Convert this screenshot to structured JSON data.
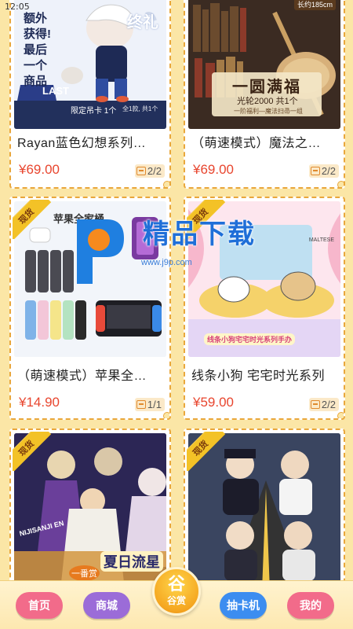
{
  "status_bar": {
    "time": "12:05"
  },
  "watermark": {
    "title": "精品下载",
    "url": "www.j9p.com"
  },
  "products": [
    {
      "title": "Rayan蓝色幻想系列…",
      "price": "¥69.00",
      "stock": "2/2",
      "badge": "",
      "image_text": {
        "lines": [
          "额外获得!",
          "最后",
          "一个商品"
        ],
        "corner": "终礼",
        "last": "LAST",
        "card": "限定吊卡 1个",
        "note": "全1款, 共1个"
      }
    },
    {
      "title": "（萌速模式）魔法之…",
      "price": "¥69.00",
      "stock": "2/2",
      "badge": "",
      "image_text": {
        "banner": "一圆满福",
        "sub": "光轮2000 共1个",
        "caption": "一阶福利—魔法扫帚一组",
        "tag": "长约185cm"
      }
    },
    {
      "title": "（萌速模式）苹果全…",
      "price": "¥14.90",
      "stock": "1/1",
      "badge": "现货",
      "image_text": {
        "header": "苹果全家桶"
      }
    },
    {
      "title": "线条小狗 宅宅时光系列",
      "price": "¥59.00",
      "stock": "2/2",
      "badge": "现货",
      "image_text": {
        "brand": "MALTESE",
        "banner": "线条小狗宅宅时光系列手办"
      }
    },
    {
      "title": "",
      "price": "",
      "stock": "",
      "badge": "现货",
      "image_text": {
        "label": "NIJISANJI EN",
        "big": "夏日流星",
        "small": "一番赏"
      }
    },
    {
      "title": "",
      "price": "",
      "stock": "",
      "badge": "现货",
      "image_text": {}
    }
  ],
  "bottom_nav": {
    "home": "首页",
    "mall": "商城",
    "center_big": "谷",
    "center_small": "谷赏",
    "gacha": "抽卡机",
    "mine": "我的",
    "colors": {
      "home": "#f26b8a",
      "mall": "#9b6cd8",
      "gacha": "#3c8df0",
      "mine": "#f26b8a",
      "accent": "#e8452e"
    }
  }
}
